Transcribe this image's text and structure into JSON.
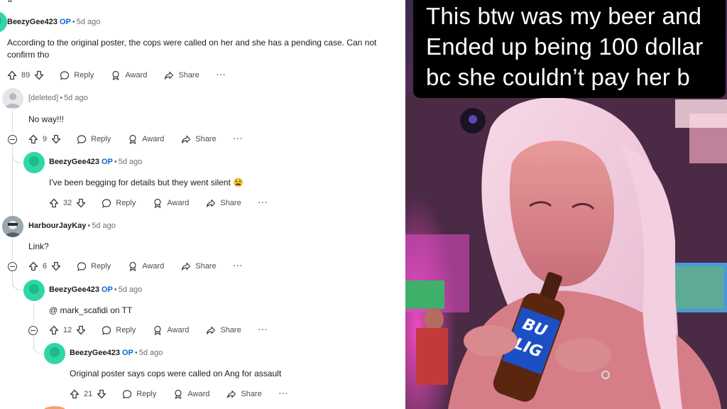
{
  "comments": [
    {
      "author": "BeezyGee423",
      "op": "OP",
      "time": "5d ago",
      "body": "According to the original poster, the cops were called on her and she has a pending case. Can not confirm tho",
      "votes": "89",
      "reply": "Reply",
      "award": "Award",
      "share": "Share",
      "more": "···"
    },
    {
      "author": "[deleted]",
      "time": "5d ago",
      "body": "No way!!!",
      "votes": "9",
      "reply": "Reply",
      "award": "Award",
      "share": "Share",
      "more": "···"
    },
    {
      "author": "BeezyGee423",
      "op": "OP",
      "time": "5d ago",
      "body": "I've been begging for details but they went silent 😫",
      "votes": "32",
      "reply": "Reply",
      "award": "Award",
      "share": "Share",
      "more": "···"
    },
    {
      "author": "HarbourJayKay",
      "time": "5d ago",
      "body": "Link?",
      "votes": "6",
      "reply": "Reply",
      "award": "Award",
      "share": "Share",
      "more": "···"
    },
    {
      "author": "BeezyGee423",
      "op": "OP",
      "time": "5d ago",
      "body": "@ mark_scafidi on TT",
      "votes": "12",
      "reply": "Reply",
      "award": "Award",
      "share": "Share",
      "more": "···"
    },
    {
      "author": "BeezyGee423",
      "op": "OP",
      "time": "5d ago",
      "body": "Original poster says cops were called on Ang for assault",
      "votes": "21",
      "reply": "Reply",
      "award": "Award",
      "share": "Share",
      "more": "···"
    }
  ],
  "photo": {
    "caption_lines": [
      "This btw was my beer and",
      "Ended up being 100 dollar",
      "bc she couldn’t  pay her b"
    ],
    "bottle_label": [
      "BU",
      "LIG"
    ]
  },
  "colors": {
    "op": "#0a66d8",
    "avatar": "#2fd6a6",
    "caption_bg": "#000000"
  }
}
